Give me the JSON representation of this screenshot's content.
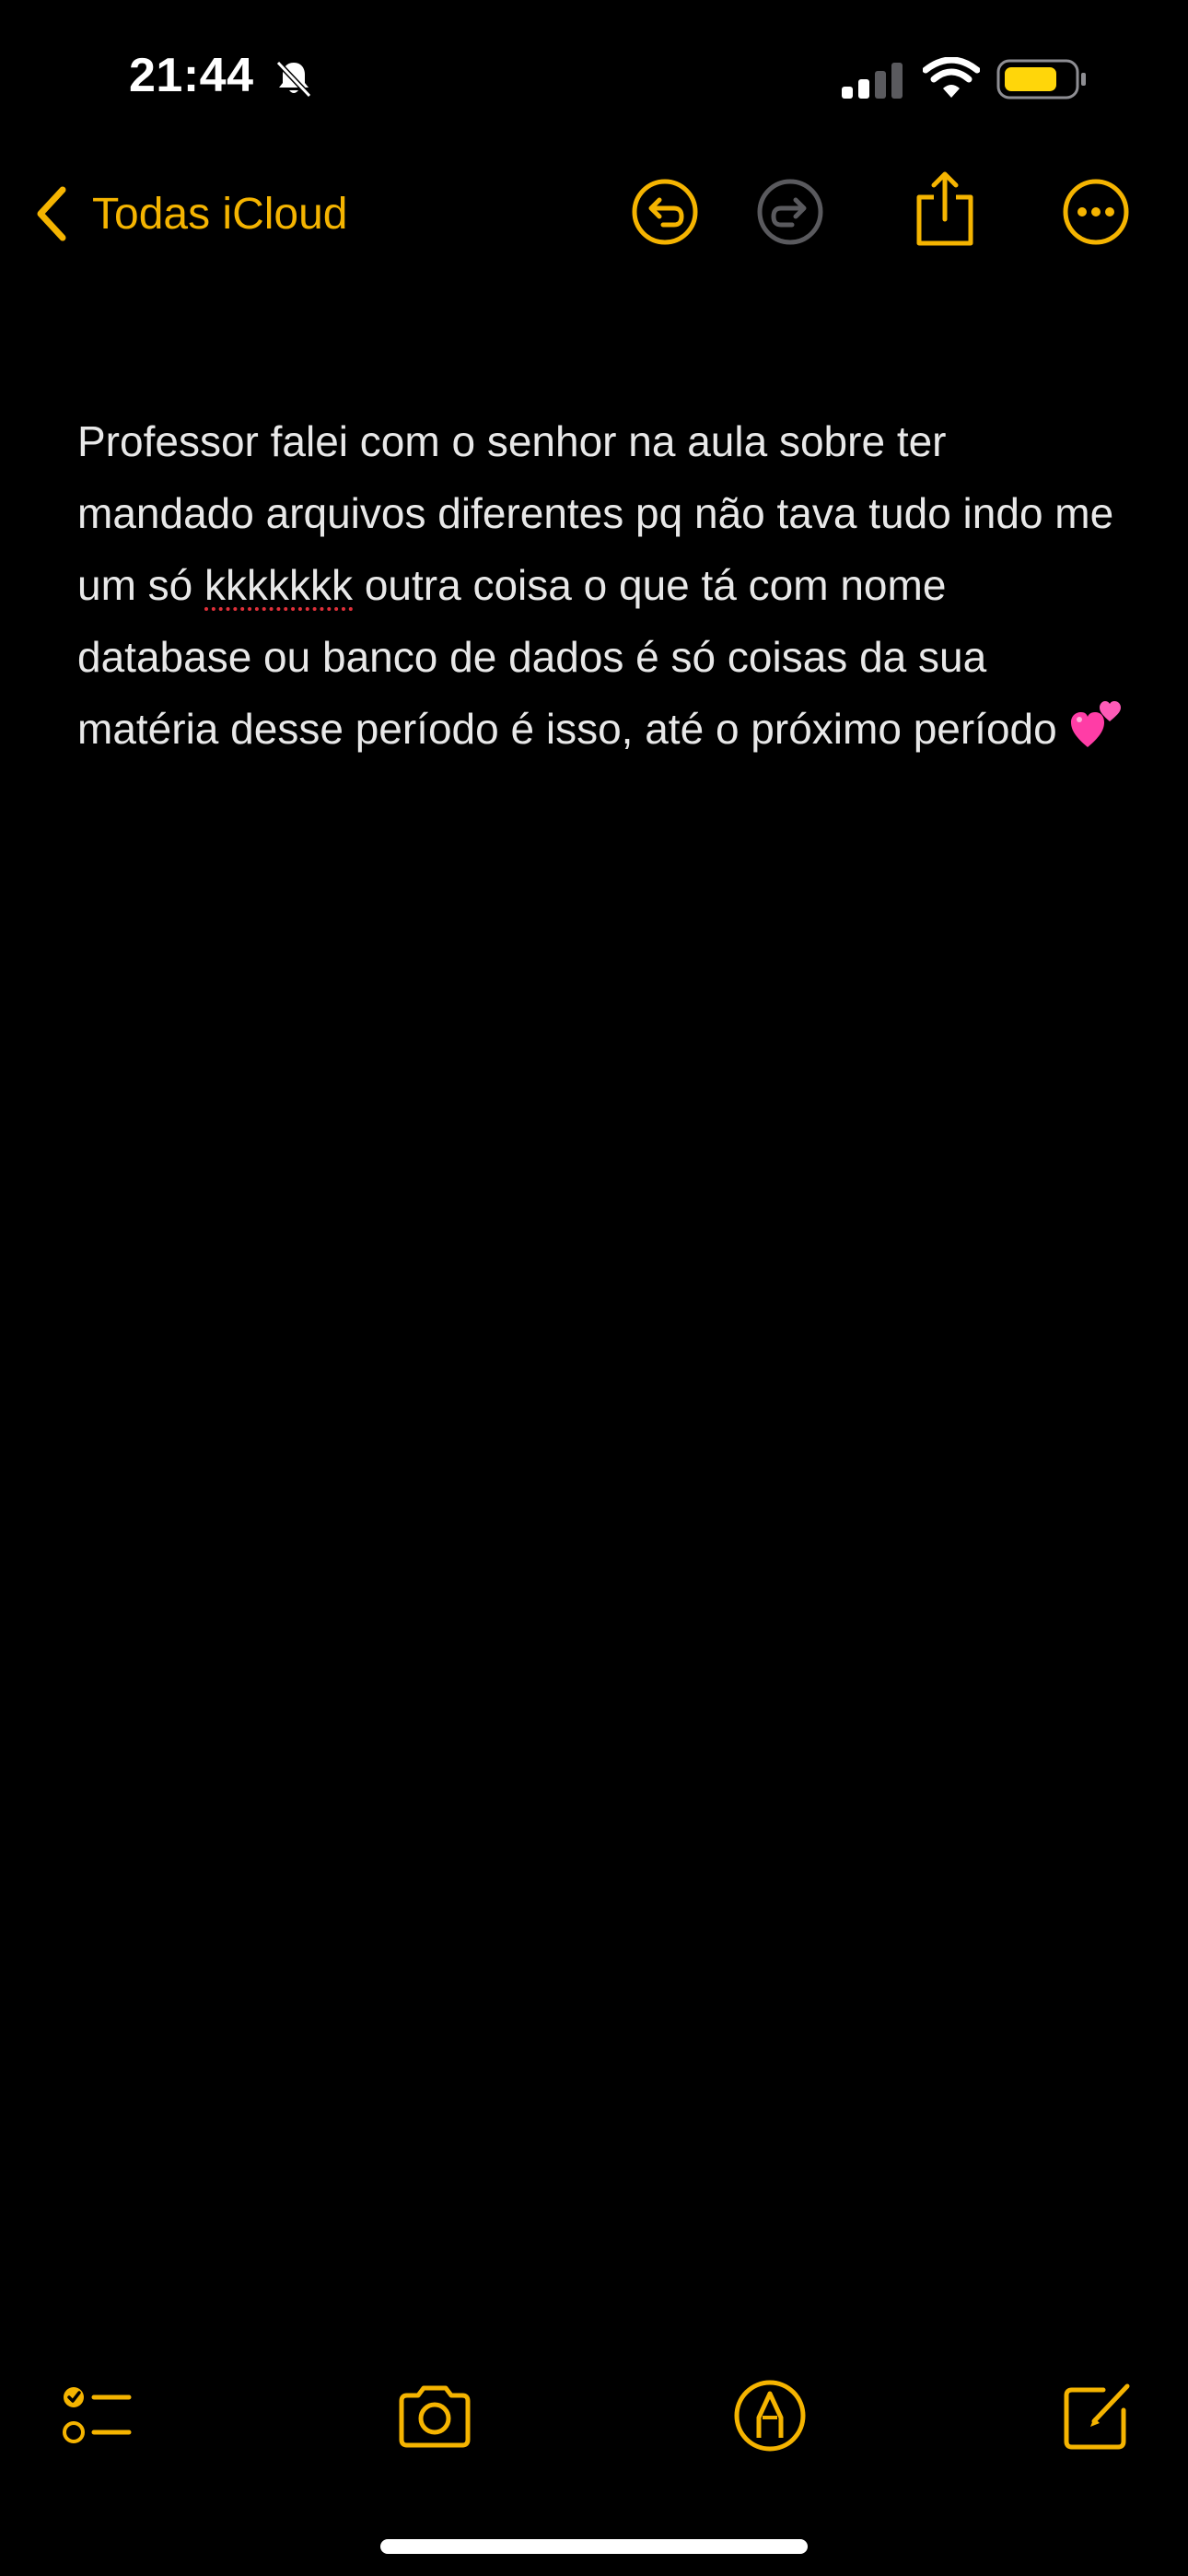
{
  "status_bar": {
    "time": "21:44",
    "icons": [
      "bell-slash-icon",
      "cellular-signal-icon",
      "wifi-icon",
      "battery-icon"
    ],
    "battery_color": "#ffd60a"
  },
  "nav": {
    "back_label": "Todas iCloud",
    "icons": [
      "undo-icon",
      "redo-icon",
      "share-icon",
      "more-icon"
    ]
  },
  "note": {
    "text_before": "Professor falei com o senhor na aula sobre ter mandado arquivos diferentes pq não tava tudo indo me um só ",
    "misspelled_word": "kkkkkkk",
    "text_after": " outra coisa o que tá com nome database ou banco de dados é só coisas da sua matéria desse período é isso, até o próximo período ",
    "emoji": "two-hearts-emoji"
  },
  "toolbar": {
    "icons": [
      "checklist-icon",
      "camera-icon",
      "markup-icon",
      "compose-icon"
    ]
  },
  "colors": {
    "accent": "#f5b400",
    "disabled": "#5a5a5e",
    "background": "#000000",
    "text": "#e8e8e8"
  }
}
